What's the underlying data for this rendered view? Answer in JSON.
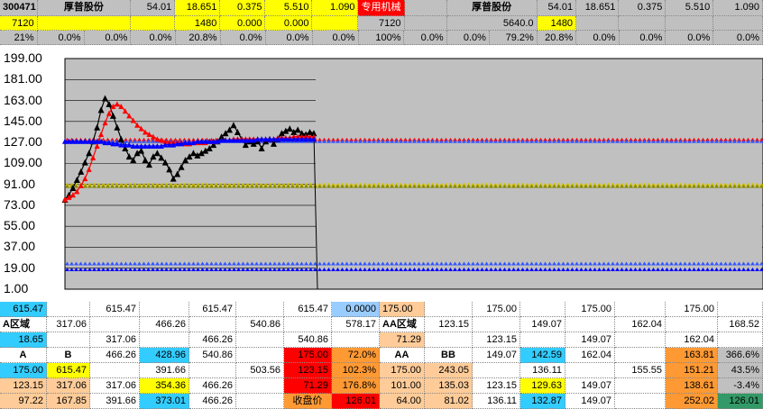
{
  "header": {
    "row1": [
      {
        "v": "300471",
        "bg": "#c0c0c0",
        "w": 44,
        "bold": true,
        "align": "left"
      },
      {
        "v": "厚普股份",
        "bg": "#c0c0c0",
        "w": 110,
        "bold": true,
        "align": "center"
      },
      {
        "v": "54.01",
        "bg": "#c0c0c0",
        "w": 52
      },
      {
        "v": "18.651",
        "bg": "#ffff00",
        "w": 53
      },
      {
        "v": "0.375",
        "bg": "#ffff00",
        "w": 53
      },
      {
        "v": "5.510",
        "bg": "#ffff00",
        "w": 55
      },
      {
        "v": "1.090",
        "bg": "#ffff00",
        "w": 54
      },
      {
        "v": "专用机械",
        "bg": "#ff0000",
        "w": 54,
        "color": "#ffffff",
        "align": "center"
      },
      {
        "v": "",
        "bg": "#c0c0c0",
        "w": 50
      },
      {
        "v": "厚普股份",
        "bg": "#c0c0c0",
        "w": 106,
        "bold": true,
        "align": "center"
      },
      {
        "v": "54.01",
        "bg": "#c0c0c0",
        "w": 46
      },
      {
        "v": "18.651",
        "bg": "#c0c0c0",
        "w": 50
      },
      {
        "v": "0.375",
        "bg": "#c0c0c0",
        "w": 55
      },
      {
        "v": "5.510",
        "bg": "#c0c0c0",
        "w": 56
      },
      {
        "v": "1.090",
        "bg": "#c0c0c0",
        "w": 58
      }
    ],
    "row2": [
      {
        "v": "7120",
        "bg": "#ffff00",
        "w": 44
      },
      {
        "v": "",
        "bg": "#ffff00",
        "w": 110
      },
      {
        "v": "",
        "bg": "#ffff00",
        "w": 52
      },
      {
        "v": "1480",
        "bg": "#ffff00",
        "w": 53
      },
      {
        "v": "0.000",
        "bg": "#ffff00",
        "w": 53
      },
      {
        "v": "0.000",
        "bg": "#ffff00",
        "w": 55
      },
      {
        "v": "",
        "bg": "#ffff00",
        "w": 54
      },
      {
        "v": "7120",
        "bg": "#c0c0c0",
        "w": 54
      },
      {
        "v": "",
        "bg": "#c0c0c0",
        "w": 50
      },
      {
        "v": "5640.0",
        "bg": "#c0c0c0",
        "w": 106
      },
      {
        "v": "1480",
        "bg": "#ffff00",
        "w": 46
      },
      {
        "v": "",
        "bg": "#c0c0c0",
        "w": 50
      },
      {
        "v": "",
        "bg": "#c0c0c0",
        "w": 55
      },
      {
        "v": "",
        "bg": "#c0c0c0",
        "w": 56
      },
      {
        "v": "",
        "bg": "#c0c0c0",
        "w": 58
      }
    ],
    "row3": [
      {
        "v": "21%",
        "bg": "#c0c0c0",
        "w": 44
      },
      {
        "v": "0.0%",
        "bg": "#c0c0c0",
        "w": 55
      },
      {
        "v": "0.0%",
        "bg": "#c0c0c0",
        "w": 55
      },
      {
        "v": "0.0%",
        "bg": "#c0c0c0",
        "w": 52
      },
      {
        "v": "20.8%",
        "bg": "#c0c0c0",
        "w": 53
      },
      {
        "v": "0.0%",
        "bg": "#c0c0c0",
        "w": 53
      },
      {
        "v": "0.0%",
        "bg": "#c0c0c0",
        "w": 55
      },
      {
        "v": "0.0%",
        "bg": "#c0c0c0",
        "w": 54
      },
      {
        "v": "100%",
        "bg": "#c0c0c0",
        "w": 54
      },
      {
        "v": "0.0%",
        "bg": "#c0c0c0",
        "w": 50
      },
      {
        "v": "0.0%",
        "bg": "#c0c0c0",
        "w": 50
      },
      {
        "v": "79.2%",
        "bg": "#c0c0c0",
        "w": 56
      },
      {
        "v": "20.8%",
        "bg": "#c0c0c0",
        "w": 46
      },
      {
        "v": "0.0%",
        "bg": "#c0c0c0",
        "w": 50
      },
      {
        "v": "0.0%",
        "bg": "#c0c0c0",
        "w": 55
      },
      {
        "v": "0.0%",
        "bg": "#c0c0c0",
        "w": 56
      },
      {
        "v": "0.0%",
        "bg": "#c0c0c0",
        "w": 58
      }
    ]
  },
  "chart_data": {
    "type": "line",
    "yticks": [
      "199.00",
      "181.00",
      "163.00",
      "145.00",
      "127.00",
      "109.00",
      "91.00",
      "73.00",
      "55.00",
      "37.00",
      "19.00",
      "1.00"
    ],
    "ylim": [
      1,
      199
    ],
    "grid": true,
    "series": [
      {
        "color": "#000000",
        "marker": "triangle",
        "values": [
          78,
          82,
          88,
          95,
          102,
          110,
          118,
          128,
          140,
          155,
          165,
          160,
          150,
          140,
          130,
          122,
          115,
          112,
          118,
          120,
          112,
          108,
          115,
          118,
          114,
          110,
          104,
          96,
          100,
          106,
          112,
          115,
          118,
          116,
          118,
          120,
          122,
          125,
          128,
          132,
          135,
          138,
          142,
          136,
          130,
          125,
          128,
          126,
          128,
          122,
          128,
          130,
          126,
          130,
          135,
          137,
          139,
          136,
          138,
          135,
          134,
          136,
          135
        ]
      },
      {
        "color": "#ff0000",
        "marker": "triangle",
        "values": [
          78,
          80,
          82,
          85,
          90,
          96,
          104,
          114,
          124,
          134,
          144,
          152,
          158,
          160,
          158,
          154,
          150,
          146,
          142,
          139,
          136,
          134,
          132,
          130,
          129,
          128,
          127,
          127,
          127,
          127,
          126,
          126,
          127,
          127,
          127,
          127,
          128,
          128,
          128,
          129,
          129,
          129,
          130,
          130,
          130,
          130,
          130,
          130,
          130,
          130,
          130,
          130,
          130,
          131,
          131,
          131,
          131,
          132,
          132,
          132,
          132,
          132,
          132
        ]
      },
      {
        "color": "#0000ff",
        "marker": "triangle",
        "values": [
          128,
          128,
          128,
          128,
          128,
          128,
          128,
          128,
          128,
          128,
          127,
          127,
          126,
          126,
          125,
          125,
          125,
          124,
          124,
          124,
          124,
          124,
          124,
          124,
          124,
          125,
          125,
          125,
          126,
          126,
          127,
          127,
          127,
          128,
          128,
          128,
          128,
          128,
          128,
          129,
          129,
          129,
          129,
          129,
          129,
          129,
          129,
          129,
          130,
          130,
          130,
          130,
          130,
          130,
          130,
          130,
          130,
          130,
          130,
          130,
          130,
          130,
          130
        ]
      }
    ],
    "bands": [
      {
        "y": 129.5,
        "color": "#ff0000"
      },
      {
        "y": 128.0,
        "color": "#3355ff"
      },
      {
        "y": 91.0,
        "color": "#d4c400"
      },
      {
        "y": 89.5,
        "color": "#888800"
      },
      {
        "y": 23.0,
        "color": "#3355ff"
      },
      {
        "y": 18.0,
        "color": "#0000ff"
      }
    ]
  },
  "bottom": {
    "rows": [
      [
        {
          "v": "615.47",
          "bg": "#33ccff",
          "w": 52
        },
        {
          "v": "",
          "bg": "#ffffff",
          "w": 48
        },
        {
          "v": "615.47",
          "bg": "#ffffff",
          "w": 55
        },
        {
          "v": "",
          "bg": "#ffffff",
          "w": 55
        },
        {
          "v": "615.47",
          "bg": "#ffffff",
          "w": 52
        },
        {
          "v": "",
          "bg": "#ffffff",
          "w": 53
        },
        {
          "v": "615.47",
          "bg": "#ffffff",
          "w": 53
        },
        {
          "v": "0.0000",
          "bg": "#99ccff",
          "w": 53
        },
        {
          "v": "175.00",
          "bg": "#ffcc99",
          "w": 50,
          "align": "left"
        },
        {
          "v": "",
          "bg": "#ffffff",
          "w": 53
        },
        {
          "v": "175.00",
          "bg": "#ffffff",
          "w": 53
        },
        {
          "v": "",
          "bg": "#ffffff",
          "w": 50
        },
        {
          "v": "175.00",
          "bg": "#ffffff",
          "w": 55
        },
        {
          "v": "",
          "bg": "#ffffff",
          "w": 56
        },
        {
          "v": "175.00",
          "bg": "#ffffff",
          "w": 58
        },
        {
          "v": "",
          "bg": "#ffffff",
          "w": 50
        }
      ],
      [
        {
          "v": "A区域",
          "bg": "#ffffff",
          "w": 52,
          "bold": true,
          "align": "left"
        },
        {
          "v": "317.06",
          "bg": "#ffffff",
          "w": 48
        },
        {
          "v": "",
          "bg": "#ffffff",
          "w": 55
        },
        {
          "v": "466.26",
          "bg": "#ffffff",
          "w": 55
        },
        {
          "v": "",
          "bg": "#ffffff",
          "w": 52
        },
        {
          "v": "540.86",
          "bg": "#ffffff",
          "w": 53
        },
        {
          "v": "",
          "bg": "#ffffff",
          "w": 53
        },
        {
          "v": "578.17",
          "bg": "#ffffff",
          "w": 53
        },
        {
          "v": "AA区域",
          "bg": "#ffffff",
          "w": 50,
          "bold": true,
          "align": "left"
        },
        {
          "v": "123.15",
          "bg": "#ffffff",
          "w": 53
        },
        {
          "v": "",
          "bg": "#ffffff",
          "w": 53
        },
        {
          "v": "149.07",
          "bg": "#ffffff",
          "w": 50
        },
        {
          "v": "",
          "bg": "#ffffff",
          "w": 55
        },
        {
          "v": "162.04",
          "bg": "#ffffff",
          "w": 56
        },
        {
          "v": "",
          "bg": "#ffffff",
          "w": 58
        },
        {
          "v": "168.52",
          "bg": "#ffffff",
          "w": 50
        }
      ],
      [
        {
          "v": "18.65",
          "bg": "#33ccff",
          "w": 52
        },
        {
          "v": "",
          "bg": "#ffffff",
          "w": 48
        },
        {
          "v": "317.06",
          "bg": "#ffffff",
          "w": 55
        },
        {
          "v": "",
          "bg": "#ffffff",
          "w": 55
        },
        {
          "v": "466.26",
          "bg": "#ffffff",
          "w": 52
        },
        {
          "v": "",
          "bg": "#ffffff",
          "w": 53
        },
        {
          "v": "540.86",
          "bg": "#ffffff",
          "w": 53
        },
        {
          "v": "",
          "bg": "#ffffff",
          "w": 53
        },
        {
          "v": "71.29",
          "bg": "#ffcc99",
          "w": 50
        },
        {
          "v": "",
          "bg": "#ffffff",
          "w": 53
        },
        {
          "v": "123.15",
          "bg": "#ffffff",
          "w": 53
        },
        {
          "v": "",
          "bg": "#ffffff",
          "w": 50
        },
        {
          "v": "149.07",
          "bg": "#ffffff",
          "w": 55
        },
        {
          "v": "",
          "bg": "#ffffff",
          "w": 56
        },
        {
          "v": "162.04",
          "bg": "#ffffff",
          "w": 58
        },
        {
          "v": "",
          "bg": "#ffffff",
          "w": 50
        }
      ],
      [
        {
          "v": "A",
          "bg": "#ffffff",
          "w": 52,
          "bold": true,
          "align": "center"
        },
        {
          "v": "B",
          "bg": "#ffffff",
          "w": 48,
          "bold": true,
          "align": "center"
        },
        {
          "v": "466.26",
          "bg": "#ffffff",
          "w": 55
        },
        {
          "v": "428.96",
          "bg": "#33ccff",
          "w": 55
        },
        {
          "v": "540.86",
          "bg": "#ffffff",
          "w": 52
        },
        {
          "v": "",
          "bg": "#ffffff",
          "w": 53
        },
        {
          "v": "175.00",
          "bg": "#ff0000",
          "w": 53
        },
        {
          "v": "72.0%",
          "bg": "#ff9933",
          "w": 53
        },
        {
          "v": "AA",
          "bg": "#ffffff",
          "w": 50,
          "bold": true,
          "align": "center"
        },
        {
          "v": "BB",
          "bg": "#ffffff",
          "w": 53,
          "bold": true,
          "align": "center"
        },
        {
          "v": "149.07",
          "bg": "#ffffff",
          "w": 53
        },
        {
          "v": "142.59",
          "bg": "#33ccff",
          "w": 50
        },
        {
          "v": "162.04",
          "bg": "#ffffff",
          "w": 55
        },
        {
          "v": "",
          "bg": "#ffffff",
          "w": 56
        },
        {
          "v": "163.81",
          "bg": "#ff9933",
          "w": 58
        },
        {
          "v": "366.6%",
          "bg": "#c0c0c0",
          "w": 50
        }
      ],
      [
        {
          "v": "175.00",
          "bg": "#33ccff",
          "w": 52
        },
        {
          "v": "615.47",
          "bg": "#ffff00",
          "w": 48
        },
        {
          "v": "",
          "bg": "#ffffff",
          "w": 55
        },
        {
          "v": "391.66",
          "bg": "#ffffff",
          "w": 55
        },
        {
          "v": "",
          "bg": "#ffffff",
          "w": 52
        },
        {
          "v": "503.56",
          "bg": "#ffffff",
          "w": 53
        },
        {
          "v": "123.15",
          "bg": "#ff0000",
          "w": 53
        },
        {
          "v": "102.3%",
          "bg": "#ff9933",
          "w": 53
        },
        {
          "v": "175.00",
          "bg": "#ffcc99",
          "w": 50
        },
        {
          "v": "243.05",
          "bg": "#ffcc99",
          "w": 53
        },
        {
          "v": "",
          "bg": "#ffffff",
          "w": 53
        },
        {
          "v": "136.11",
          "bg": "#ffffff",
          "w": 50
        },
        {
          "v": "",
          "bg": "#ffffff",
          "w": 55
        },
        {
          "v": "155.55",
          "bg": "#ffffff",
          "w": 56
        },
        {
          "v": "151.21",
          "bg": "#ff9933",
          "w": 58
        },
        {
          "v": "43.5%",
          "bg": "#c0c0c0",
          "w": 50
        }
      ],
      [
        {
          "v": "123.15",
          "bg": "#ffcc99",
          "w": 52
        },
        {
          "v": "317.06",
          "bg": "#ffcc99",
          "w": 48
        },
        {
          "v": "317.06",
          "bg": "#ffffff",
          "w": 55
        },
        {
          "v": "354.36",
          "bg": "#ffff00",
          "w": 55
        },
        {
          "v": "466.26",
          "bg": "#ffffff",
          "w": 52
        },
        {
          "v": "",
          "bg": "#ffffff",
          "w": 53
        },
        {
          "v": "71.29",
          "bg": "#ff0000",
          "w": 53
        },
        {
          "v": "176.8%",
          "bg": "#ff9933",
          "w": 53
        },
        {
          "v": "101.00",
          "bg": "#ffcc99",
          "w": 50
        },
        {
          "v": "135.03",
          "bg": "#ffcc99",
          "w": 53
        },
        {
          "v": "123.15",
          "bg": "#ffffff",
          "w": 53
        },
        {
          "v": "129.63",
          "bg": "#ffff00",
          "w": 50
        },
        {
          "v": "149.07",
          "bg": "#ffffff",
          "w": 55
        },
        {
          "v": "",
          "bg": "#ffffff",
          "w": 56
        },
        {
          "v": "138.61",
          "bg": "#ff9933",
          "w": 58
        },
        {
          "v": "-3.4%",
          "bg": "#c0c0c0",
          "w": 50
        }
      ],
      [
        {
          "v": "97.22",
          "bg": "#ffcc99",
          "w": 52
        },
        {
          "v": "167.85",
          "bg": "#ffcc99",
          "w": 48
        },
        {
          "v": "391.66",
          "bg": "#ffffff",
          "w": 55
        },
        {
          "v": "373.01",
          "bg": "#33ccff",
          "w": 55
        },
        {
          "v": "466.26",
          "bg": "#ffffff",
          "w": 52
        },
        {
          "v": "",
          "bg": "#ffffff",
          "w": 53
        },
        {
          "v": "收盘价",
          "bg": "#ff9933",
          "w": 53,
          "align": "center"
        },
        {
          "v": "126.01",
          "bg": "#ff0000",
          "w": 53
        },
        {
          "v": "64.00",
          "bg": "#ffcc99",
          "w": 50
        },
        {
          "v": "81.02",
          "bg": "#ffcc99",
          "w": 53
        },
        {
          "v": "136.11",
          "bg": "#ffffff",
          "w": 53
        },
        {
          "v": "132.87",
          "bg": "#33ccff",
          "w": 50
        },
        {
          "v": "149.07",
          "bg": "#ffffff",
          "w": 55
        },
        {
          "v": "",
          "bg": "#ffffff",
          "w": 56
        },
        {
          "v": "252.02",
          "bg": "#ff9933",
          "w": 58
        },
        {
          "v": "126.01",
          "bg": "#339966",
          "w": 50
        }
      ]
    ]
  }
}
